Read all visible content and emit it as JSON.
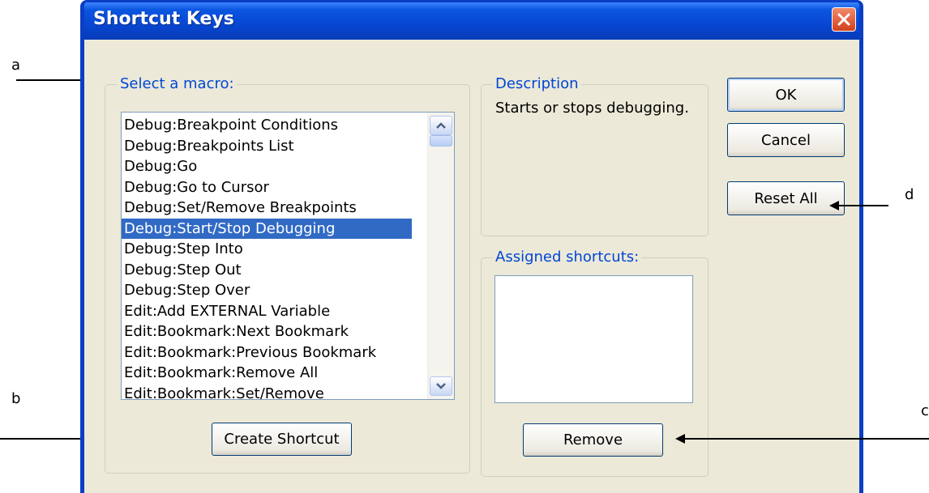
{
  "window": {
    "title": "Shortcut Keys",
    "close_icon": "close-icon",
    "titlebar_color": "#0a56e0",
    "close_color": "#d2401c"
  },
  "macro_group": {
    "label": "Select a macro:",
    "items": [
      "Debug:Breakpoint Conditions",
      "Debug:Breakpoints List",
      "Debug:Go",
      "Debug:Go to Cursor",
      "Debug:Set/Remove Breakpoints",
      "Debug:Start/Stop Debugging",
      "Debug:Step Into",
      "Debug:Step Out",
      "Debug:Step Over",
      "Edit:Add EXTERNAL Variable",
      "Edit:Bookmark:Next Bookmark",
      "Edit:Bookmark:Previous Bookmark",
      "Edit:Bookmark:Remove All",
      "Edit:Bookmark:Set/Remove"
    ],
    "selected_item": "Debug:Start/Stop Debugging",
    "create_button": "Create Shortcut",
    "selection_color": "#316ac5"
  },
  "description_group": {
    "label": "Description",
    "text": "Starts or stops debugging."
  },
  "shortcuts_group": {
    "label": "Assigned shortcuts:",
    "remove_button": "Remove"
  },
  "buttons": {
    "ok": "OK",
    "cancel": "Cancel",
    "reset_all": "Reset All"
  },
  "callouts": {
    "a": "a",
    "b": "b",
    "c": "c",
    "d": "d"
  }
}
